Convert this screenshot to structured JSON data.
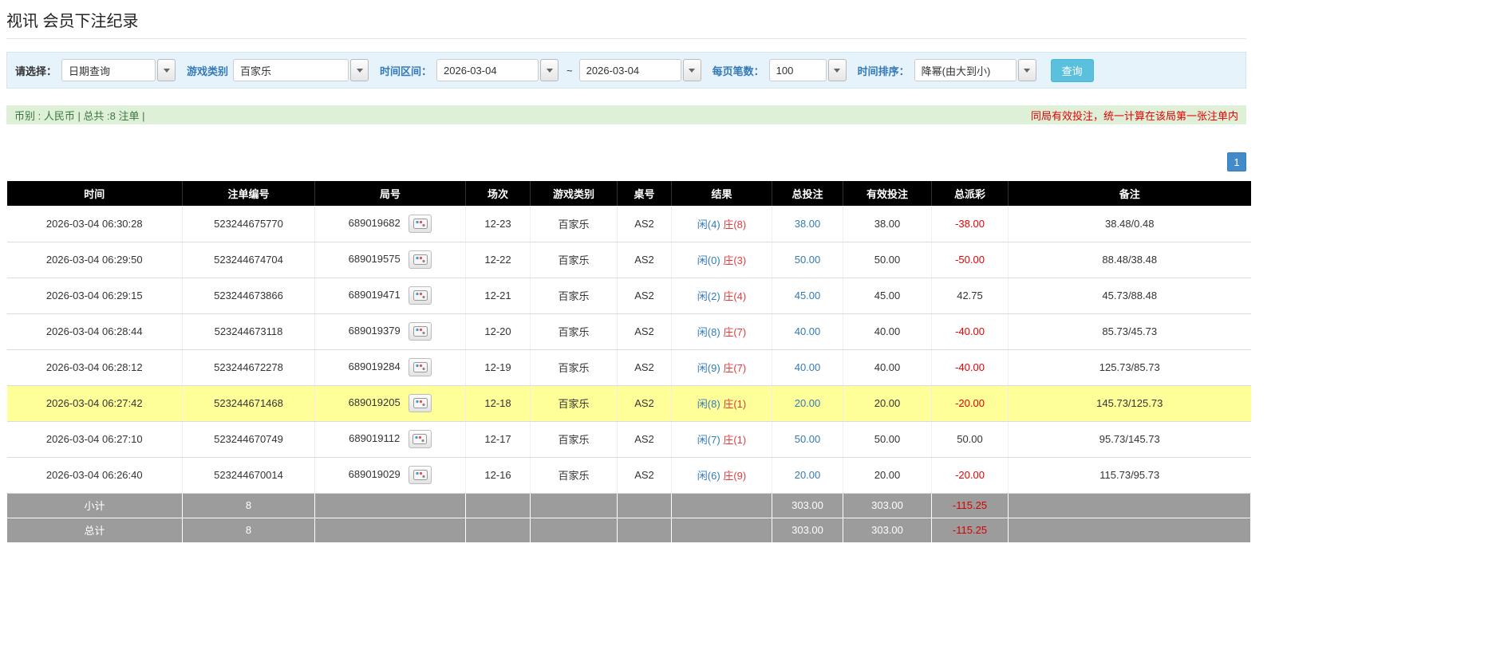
{
  "page": {
    "title": "视讯 会员下注纪录"
  },
  "filters": {
    "select_label": "请选择：",
    "select_value": "日期查询",
    "game_type_label": "游戏类别",
    "game_type_value": "百家乐",
    "time_range_label": "时间区间：",
    "date_from": "2026-03-04",
    "range_separator": "~",
    "date_to": "2026-03-04",
    "page_size_label": "每页笔数：",
    "page_size_value": "100",
    "sort_label": "时间排序：",
    "sort_value": "降幂(由大到小)",
    "search_button": "查询"
  },
  "info_bar": {
    "summary": "币别 : 人民币 | 总共 :8 注单 |",
    "notice": "同局有效投注，统一计算在该局第一张注单内"
  },
  "pagination": {
    "pages": [
      "1"
    ]
  },
  "colors": {
    "player_blue": "#337ab7",
    "banker_red": "#e03c3c",
    "negative_red": "#e60000",
    "highlight_yellow": "#ffff99",
    "header_black": "#000000",
    "summary_gray": "#9c9c9c",
    "filter_bar_blue": "#e7f3fb",
    "info_bar_green": "#dff0d8",
    "search_button_blue": "#5bc0de"
  },
  "table": {
    "headers": [
      "时间",
      "注单编号",
      "局号",
      "场次",
      "游戏类别",
      "桌号",
      "结果",
      "总投注",
      "有效投注",
      "总派彩",
      "备注"
    ],
    "rows": [
      {
        "time": "2026-03-04 06:30:28",
        "bet_id": "523244675770",
        "round_id": "689019682",
        "session": "12-23",
        "game": "百家乐",
        "table_no": "AS2",
        "result_player": "闲(4)",
        "result_banker": "庄(8)",
        "total_bet": "38.00",
        "valid_bet": "38.00",
        "payout": "-38.00",
        "remark": "38.48/0.48",
        "highlighted": false
      },
      {
        "time": "2026-03-04 06:29:50",
        "bet_id": "523244674704",
        "round_id": "689019575",
        "session": "12-22",
        "game": "百家乐",
        "table_no": "AS2",
        "result_player": "闲(0)",
        "result_banker": "庄(3)",
        "total_bet": "50.00",
        "valid_bet": "50.00",
        "payout": "-50.00",
        "remark": "88.48/38.48",
        "highlighted": false
      },
      {
        "time": "2026-03-04 06:29:15",
        "bet_id": "523244673866",
        "round_id": "689019471",
        "session": "12-21",
        "game": "百家乐",
        "table_no": "AS2",
        "result_player": "闲(2)",
        "result_banker": "庄(4)",
        "total_bet": "45.00",
        "valid_bet": "45.00",
        "payout": "42.75",
        "remark": "45.73/88.48",
        "highlighted": false
      },
      {
        "time": "2026-03-04 06:28:44",
        "bet_id": "523244673118",
        "round_id": "689019379",
        "session": "12-20",
        "game": "百家乐",
        "table_no": "AS2",
        "result_player": "闲(8)",
        "result_banker": "庄(7)",
        "total_bet": "40.00",
        "valid_bet": "40.00",
        "payout": "-40.00",
        "remark": "85.73/45.73",
        "highlighted": false
      },
      {
        "time": "2026-03-04 06:28:12",
        "bet_id": "523244672278",
        "round_id": "689019284",
        "session": "12-19",
        "game": "百家乐",
        "table_no": "AS2",
        "result_player": "闲(9)",
        "result_banker": "庄(7)",
        "total_bet": "40.00",
        "valid_bet": "40.00",
        "payout": "-40.00",
        "remark": "125.73/85.73",
        "highlighted": false
      },
      {
        "time": "2026-03-04 06:27:42",
        "bet_id": "523244671468",
        "round_id": "689019205",
        "session": "12-18",
        "game": "百家乐",
        "table_no": "AS2",
        "result_player": "闲(8)",
        "result_banker": "庄(1)",
        "total_bet": "20.00",
        "valid_bet": "20.00",
        "payout": "-20.00",
        "remark": "145.73/125.73",
        "highlighted": true
      },
      {
        "time": "2026-03-04 06:27:10",
        "bet_id": "523244670749",
        "round_id": "689019112",
        "session": "12-17",
        "game": "百家乐",
        "table_no": "AS2",
        "result_player": "闲(7)",
        "result_banker": "庄(1)",
        "total_bet": "50.00",
        "valid_bet": "50.00",
        "payout": "50.00",
        "remark": "95.73/145.73",
        "highlighted": false
      },
      {
        "time": "2026-03-04 06:26:40",
        "bet_id": "523244670014",
        "round_id": "689019029",
        "session": "12-16",
        "game": "百家乐",
        "table_no": "AS2",
        "result_player": "闲(6)",
        "result_banker": "庄(9)",
        "total_bet": "20.00",
        "valid_bet": "20.00",
        "payout": "-20.00",
        "remark": "115.73/95.73",
        "highlighted": false
      }
    ],
    "footer": [
      {
        "label": "小计",
        "count": "8",
        "total_bet": "303.00",
        "valid_bet": "303.00",
        "payout": "-115.25"
      },
      {
        "label": "总计",
        "count": "8",
        "total_bet": "303.00",
        "valid_bet": "303.00",
        "payout": "-115.25"
      }
    ]
  }
}
